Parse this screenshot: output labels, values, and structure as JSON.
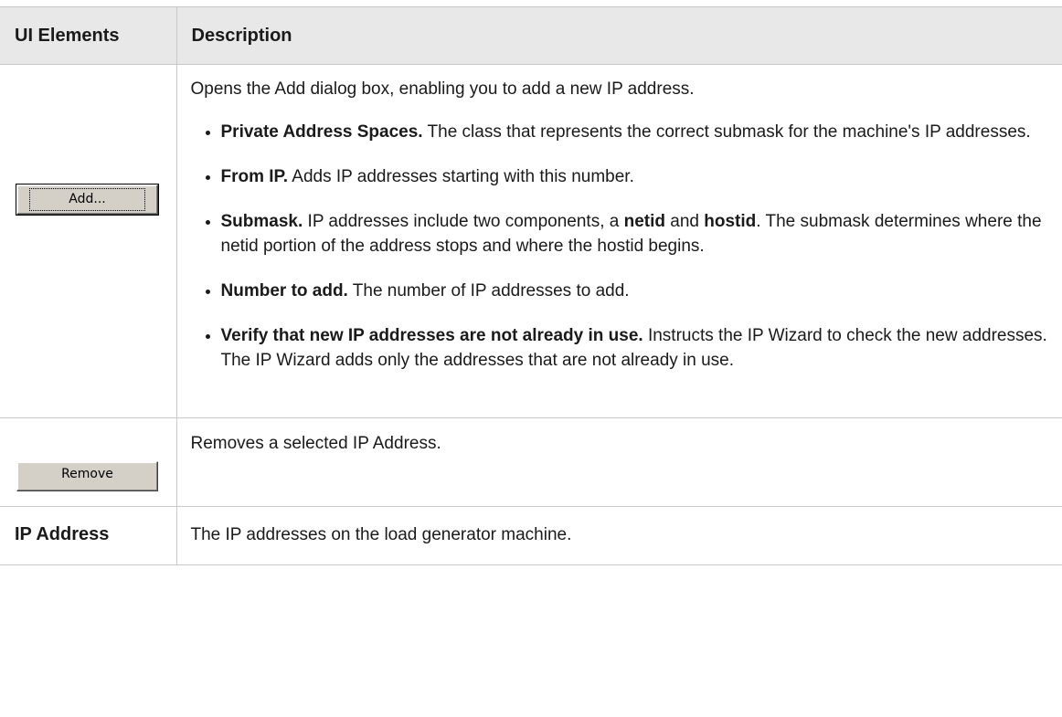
{
  "header": {
    "col1": "UI Elements",
    "col2": "Description"
  },
  "add_row": {
    "button_label": "Add...",
    "intro": "Opens the Add dialog box, enabling you to add a new IP address.",
    "items": [
      {
        "term": "Private Address Spaces.",
        "text": " The class that represents the correct submask for the machine's IP addresses."
      },
      {
        "term": "From IP.",
        "text": " Adds IP addresses starting with this number."
      },
      {
        "term": "Submask.",
        "text_a": " IP addresses include two components, a ",
        "bold_a": "netid",
        "text_b": " and ",
        "bold_b": "hostid",
        "text_c": ". The submask determines where the netid portion of the address stops and where the hostid begins."
      },
      {
        "term": "Number to add.",
        "text": " The number of IP addresses to add."
      },
      {
        "term": "Verify that new IP addresses are not already in use.",
        "text": " Instructs the IP Wizard to check the new addresses. The IP Wizard adds only the addresses that are not already in use."
      }
    ]
  },
  "remove_row": {
    "button_label": "Remove",
    "description": "Removes a selected IP Address."
  },
  "ip_row": {
    "label": "IP Address",
    "description": "The IP addresses on the load generator machine."
  }
}
